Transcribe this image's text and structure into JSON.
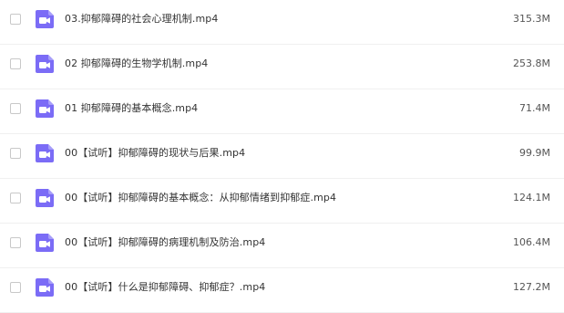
{
  "files": [
    {
      "name": "03.抑郁障碍的社会心理机制.mp4",
      "size": "315.3M",
      "icon": "video-file-icon"
    },
    {
      "name": "02 抑郁障碍的生物学机制.mp4",
      "size": "253.8M",
      "icon": "video-file-icon"
    },
    {
      "name": "01 抑郁障碍的基本概念.mp4",
      "size": "71.4M",
      "icon": "video-file-icon"
    },
    {
      "name": "00【试听】抑郁障碍的现状与后果.mp4",
      "size": "99.9M",
      "icon": "video-file-icon"
    },
    {
      "name": "00【试听】抑郁障碍的基本概念：从抑郁情绪到抑郁症.mp4",
      "size": "124.1M",
      "icon": "video-file-icon"
    },
    {
      "name": "00【试听】抑郁障碍的病理机制及防治.mp4",
      "size": "106.4M",
      "icon": "video-file-icon"
    },
    {
      "name": "00【试听】什么是抑郁障碍、抑郁症？.mp4",
      "size": "127.2M",
      "icon": "video-file-icon"
    }
  ],
  "colors": {
    "icon_bg": "#7b6cf6",
    "icon_fg": "#ffffff",
    "text": "#333333",
    "size_text": "#555555",
    "divider": "#f0f0f0"
  }
}
